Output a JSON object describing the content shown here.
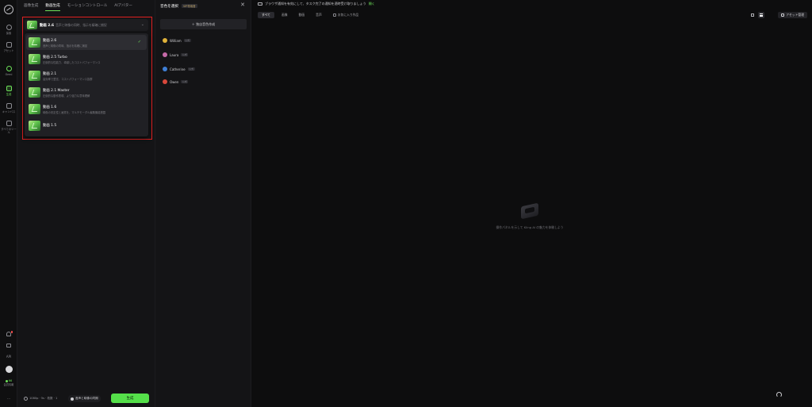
{
  "rail": {
    "items": [
      {
        "label": "探索",
        "icon": "compass-icon"
      },
      {
        "label": "アセット",
        "icon": "folder-icon"
      },
      {
        "label": "Omni",
        "icon": "omni-icon"
      },
      {
        "label": "生成",
        "icon": "generate-icon"
      },
      {
        "label": "キャンバス",
        "icon": "canvas-icon"
      },
      {
        "label": "すべてのツール",
        "icon": "apps-icon"
      }
    ],
    "api_label": "API",
    "credits_value": "66",
    "credits_label": "会員情報",
    "more": "···"
  },
  "gen": {
    "tabs": [
      "画像生成",
      "動画生成",
      "モーションコントロール",
      "AIアバター"
    ],
    "selected_model": {
      "name": "動画 2.6",
      "desc": "音声と映像の同時、指示を精確に捕捉"
    },
    "options": [
      {
        "title": "動画 2.6",
        "desc": "音声と映像の同時、指示を精確に捕捉"
      },
      {
        "title": "動画 2.5 Turbo",
        "desc": "圧倒的な性能力、卓越したコストパフォーマンス"
      },
      {
        "title": "動画 2.1",
        "desc": "高効率で豊富、コストパフォーマンス抜群"
      },
      {
        "title": "動画 2.1 Master",
        "desc": "圧倒的な動作表現、より強力な意味理解"
      },
      {
        "title": "動画 1.6",
        "desc": "映像の安定性と画質を、マルチモーダル編集機能搭載"
      },
      {
        "title": "動画 1.5",
        "desc": ""
      }
    ],
    "check": "✓",
    "chevron": "⌄",
    "settings_summary": "1080p · 5s · 枚数 · 1",
    "audio_label": "音声と映像の同期",
    "generate_label": "生成"
  },
  "voice": {
    "title": "音色を選択",
    "vip": "VIP専用音",
    "close": "✕",
    "create_label": "＋ 独自音色作成",
    "tag": "公式",
    "voices": [
      {
        "name": "William",
        "color": "#e0b23a"
      },
      {
        "name": "Laura",
        "color": "#c56aa8"
      },
      {
        "name": "Catherine",
        "color": "#3f7fd6"
      },
      {
        "name": "Owen",
        "color": "#d9483b"
      }
    ]
  },
  "main": {
    "notice_text": "ブラウザ通知を有効にして、タスク完了の通知を適時受け取りましょう",
    "notice_link": "開く",
    "filters": [
      "すべて",
      "画像",
      "動画",
      "音声"
    ],
    "favorites_label": "お気に入り作品",
    "asset_label": "アセット管理",
    "empty_msg": "操作パネルを示して Kling AI の魅力を体験しよう"
  }
}
